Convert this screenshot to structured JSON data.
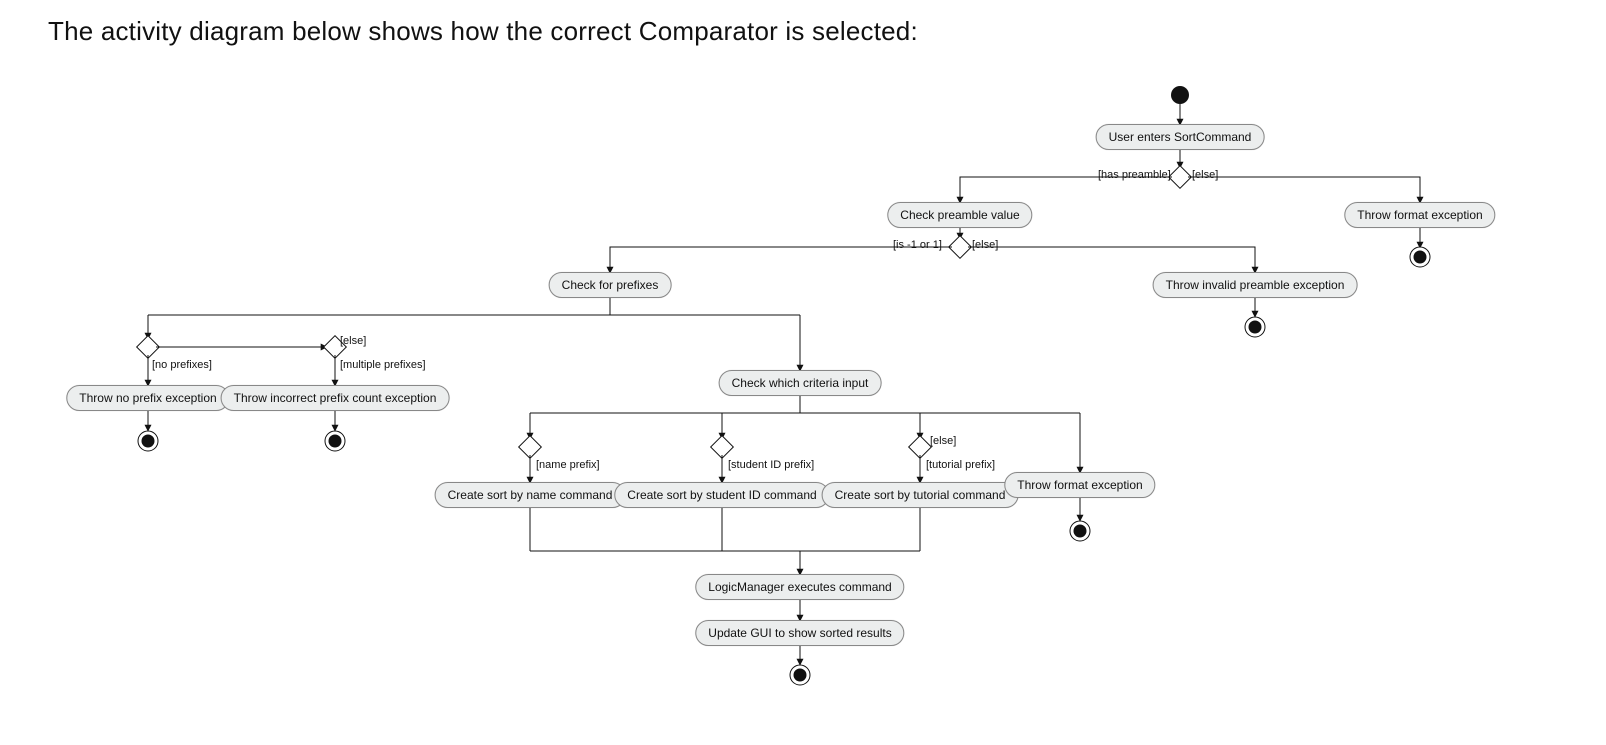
{
  "title": "The activity diagram below shows how the correct Comparator is selected:",
  "nodes": {
    "n1": "User enters SortCommand",
    "n2": "Check preamble value",
    "n3": "Throw format exception",
    "n4": "Check for prefixes",
    "n5": "Throw invalid preamble exception",
    "n6": "Throw no prefix exception",
    "n7": "Throw incorrect prefix count exception",
    "n8": "Check which criteria input",
    "n9": "Create sort by name command",
    "n10": "Create sort by student ID command",
    "n11": "Create sort by tutorial command",
    "n12": "Throw format exception",
    "n13": "LogicManager executes command",
    "n14": "Update GUI to show sorted results"
  },
  "guards": {
    "g_has_preamble": "[has preamble]",
    "g_else1": "[else]",
    "g_is_pm1": "[is -1 or 1]",
    "g_else2": "[else]",
    "g_no_prefixes": "[no prefixes]",
    "g_else3": "[else]",
    "g_multi_pref": "[multiple prefixes]",
    "g_name_pref": "[name prefix]",
    "g_sid_pref": "[student ID prefix]",
    "g_tut_pref": "[tutorial prefix]",
    "g_else4": "[else]"
  }
}
